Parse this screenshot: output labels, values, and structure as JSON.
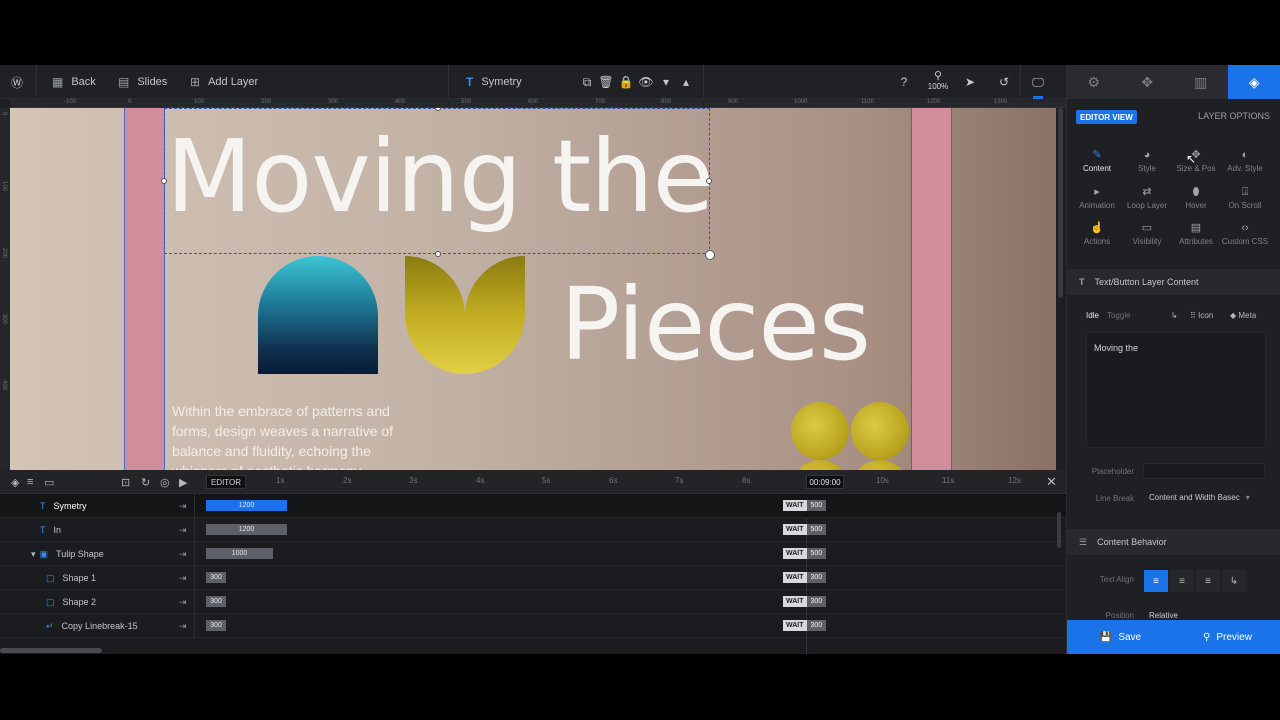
{
  "toolbar": {
    "back": "Back",
    "slides": "Slides",
    "add_layer": "Add Layer",
    "layer_name": "Symetry",
    "zoom": "100%"
  },
  "ruler": {
    "top": [
      "-100",
      "0",
      "100",
      "200",
      "300",
      "400",
      "500",
      "600",
      "700",
      "800",
      "900",
      "1000",
      "1100",
      "1200",
      "1300"
    ],
    "left": [
      "0",
      "100",
      "200",
      "300",
      "400"
    ]
  },
  "canvas": {
    "headline_1": "Moving the",
    "headline_2": "Pieces",
    "paragraph": "Within the embrace of patterns and forms, design weaves a narrative of balance and fluidity, echoing the whispers of aesthetic harmony."
  },
  "timeline": {
    "editor_tag": "EDITOR",
    "ticks": [
      "1s",
      "2s",
      "3s",
      "4s",
      "5s",
      "6s",
      "7s",
      "8s",
      "9s",
      "10s",
      "11s",
      "12s"
    ],
    "current_time": "00:09:00",
    "wait_label": "WAIT",
    "rows": [
      {
        "name": "Symetry",
        "duration": "1200",
        "wait": "500"
      },
      {
        "name": "In",
        "duration": "1200",
        "wait": "500"
      },
      {
        "name": "Tulip Shape",
        "duration": "1000",
        "wait": "500"
      },
      {
        "name": "Shape 1",
        "duration": "300",
        "wait": "300"
      },
      {
        "name": "Shape 2",
        "duration": "300",
        "wait": "300"
      },
      {
        "name": "Copy Linebreak-15",
        "duration": "300",
        "wait": "300"
      }
    ]
  },
  "panel": {
    "editor_view": "EDITOR VIEW",
    "layer_options": "LAYER OPTIONS",
    "options": [
      {
        "label": "Content",
        "icon": "pencil-icon"
      },
      {
        "label": "Style",
        "icon": "palette-icon"
      },
      {
        "label": "Size & Pos",
        "icon": "move-icon"
      },
      {
        "label": "Adv. Style",
        "icon": "drop-icon"
      },
      {
        "label": "Animation",
        "icon": "play-icon"
      },
      {
        "label": "Loop Layer",
        "icon": "loop-icon"
      },
      {
        "label": "Hover",
        "icon": "mouse-icon"
      },
      {
        "label": "On Scroll",
        "icon": "scroll-icon"
      },
      {
        "label": "Actions",
        "icon": "hand-icon"
      },
      {
        "label": "Visibility",
        "icon": "visibility-icon"
      },
      {
        "label": "Attributes",
        "icon": "document-icon"
      },
      {
        "label": "Custom CSS",
        "icon": "code-icon"
      }
    ],
    "section_content": "Text/Button Layer Content",
    "tab_idle": "Idle",
    "tab_toggle": "Toggle",
    "icon_label": "Icon",
    "meta_label": "Meta",
    "content_text": "Moving the",
    "placeholder_label": "Placeholder",
    "placeholder_value": "",
    "line_break_label": "Line Break",
    "line_break_value": "Content and Width Basec",
    "section_behavior": "Content Behavior",
    "text_align_label": "Text Align",
    "position_label": "Position",
    "position_value": "Relative",
    "save": "Save",
    "preview": "Preview"
  },
  "colors": {
    "accent": "#1a73e8",
    "pink": "#d08d9c",
    "gold": "#c9b42a",
    "teal": "#3dc6d6"
  }
}
